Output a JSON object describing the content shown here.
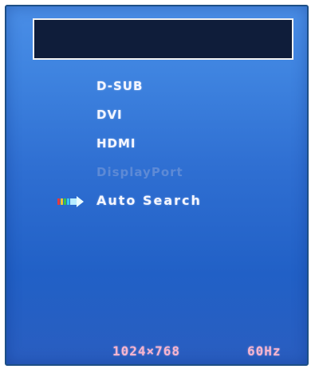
{
  "osd": {
    "title": "",
    "inputs": [
      {
        "label": "D-SUB",
        "enabled": true
      },
      {
        "label": "DVI",
        "enabled": true
      },
      {
        "label": "HDMI",
        "enabled": true
      },
      {
        "label": "DisplayPort",
        "enabled": false
      },
      {
        "label": "Auto Search",
        "enabled": true,
        "selected": true
      }
    ],
    "selector_icon": "arrow-right-icon",
    "status": {
      "resolution": "1024×768",
      "refresh": "60Hz"
    },
    "colors": {
      "background": "#3a7ad9",
      "text": "#f4f6ff",
      "disabled_text": "#5d8ad6",
      "status_text": "#f7b5cf",
      "header_box": "#0f1d3a"
    }
  }
}
